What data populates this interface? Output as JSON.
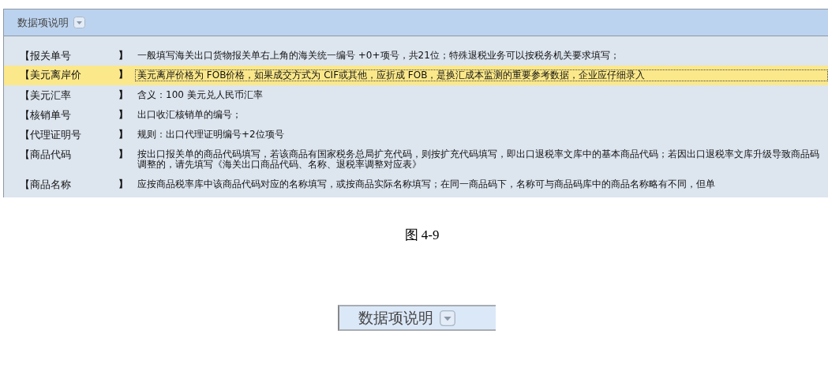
{
  "panel": {
    "title": "数据项说明",
    "rows": [
      {
        "label": "【报关单号",
        "bracket": "】",
        "description": "一般填写海关出口货物报关单右上角的海关统一编号 +0+项号，共21位；特殊退税业务可以按税务机关要求填写；",
        "selected": false
      },
      {
        "label": "【美元离岸价",
        "bracket": "】",
        "description": "美元离岸价格为 FOB价格，如果成交方式为 CIF或其他，应折成 FOB，是换汇成本监测的重要参考数据，企业应仔细录入",
        "selected": true
      },
      {
        "label": "【美元汇率",
        "bracket": "】",
        "description": "含义：100 美元兑人民币汇率",
        "selected": false
      },
      {
        "label": "【核销单号",
        "bracket": "】",
        "description": "出口收汇核销单的编号；",
        "selected": false
      },
      {
        "label": "【代理证明号",
        "bracket": "】",
        "description": "规则：出口代理证明编号+2位项号",
        "selected": false
      },
      {
        "label": "【商品代码",
        "bracket": "】",
        "description": "按出口报关单的商品代码填写，若该商品有国家税务总局扩充代码，则按扩充代码填写，即出口退税率文库中的基本商品代码；若因出口退税率文库升级导致商品码调整的，请先填写《海关出口商品代码、名称、退税率调整对应表》",
        "selected": false
      },
      {
        "label": "【商品名称",
        "bracket": "】",
        "description": "应按商品税率库中该商品代码对应的名称填写，或按商品实际名称填写；在同一商品码下，名称可与商品码库中的商品名称略有不同，但单",
        "selected": false
      }
    ]
  },
  "caption": "图 4-9",
  "detail": {
    "title": "数据项说明"
  }
}
